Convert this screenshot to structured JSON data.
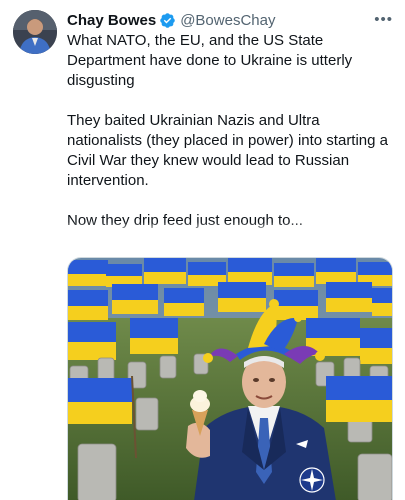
{
  "tweet": {
    "author_name": "Chay Bowes",
    "author_handle": "@BowesChay",
    "verified": true,
    "more_icon": "more-horizontal-icon",
    "paragraphs": [
      "What NATO, the EU, and the US State Department have done to Ukraine is utterly disgusting",
      "They baited Ukrainian Nazis and Ultra nationalists (they placed in power) into starting a Civil War they knew would lead to Russian intervention.",
      "Now they drip feed just enough to..."
    ]
  },
  "media": {
    "colors": {
      "flag_blue": "#2a5bd7",
      "flag_yellow": "#f5cf1e",
      "suit": "#1f3570",
      "grass": "#4f6d33"
    }
  },
  "colors": {
    "text": "#0f1419",
    "secondary": "#536471",
    "verified": "#1d9bf0"
  }
}
